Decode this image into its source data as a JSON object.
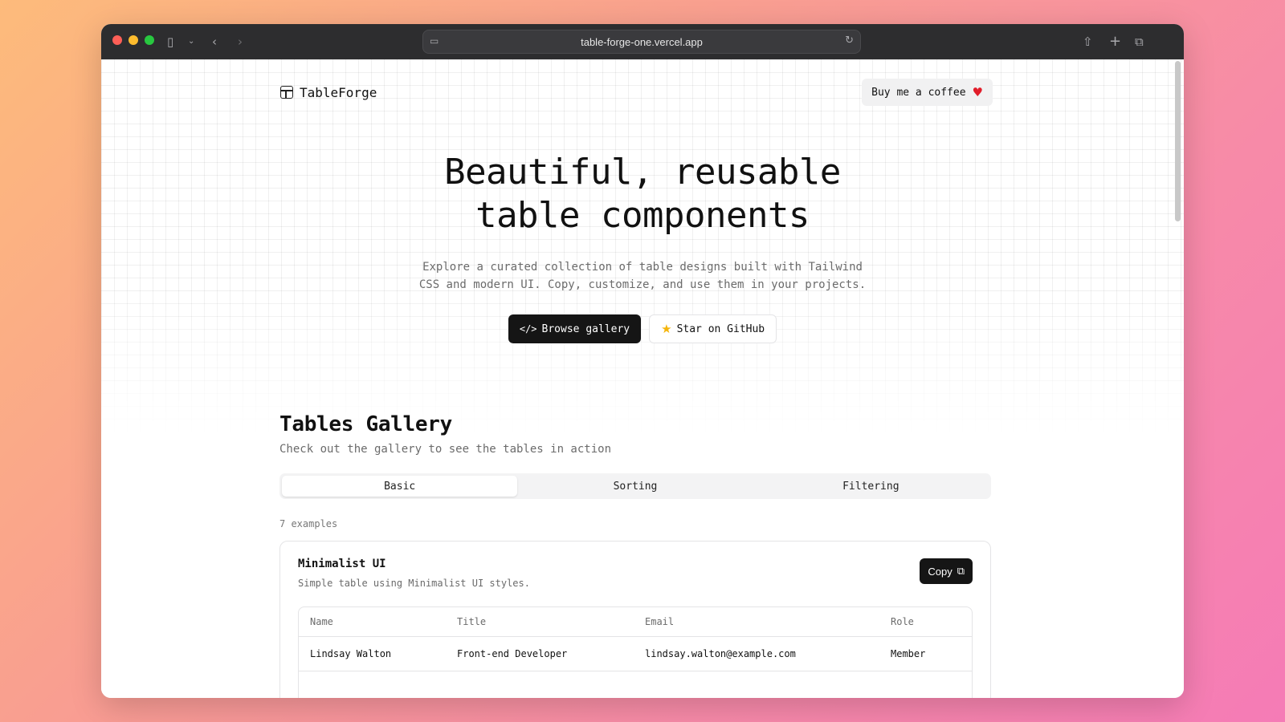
{
  "browser": {
    "url": "table-forge-one.vercel.app",
    "icons": [
      "sidebar-icon",
      "chevron-down-icon",
      "back-icon",
      "forward-icon",
      "site-settings-icon",
      "reload-icon",
      "share-icon",
      "new-tab-icon",
      "tabs-overview-icon"
    ]
  },
  "nav": {
    "brand": "TableForge",
    "coffee_label": "Buy me a coffee"
  },
  "hero": {
    "title_line1": "Beautiful, reusable",
    "title_line2": "table components",
    "description_line1": "Explore a curated collection of table designs built with Tailwind",
    "description_line2": "CSS and modern UI. Copy, customize, and use them in your projects.",
    "browse_label": "Browse gallery",
    "github_label": "Star on GitHub"
  },
  "gallery": {
    "title": "Tables Gallery",
    "subtitle": "Check out the gallery to see the tables in action",
    "tabs": [
      {
        "label": "Basic",
        "active": true
      },
      {
        "label": "Sorting",
        "active": false
      },
      {
        "label": "Filtering",
        "active": false
      }
    ],
    "count": "7 examples",
    "card": {
      "title": "Minimalist UI",
      "description": "Simple table using Minimalist UI styles.",
      "copy_label": "Copy",
      "columns": [
        "Name",
        "Title",
        "Email",
        "Role"
      ],
      "rows": [
        [
          "Lindsay Walton",
          "Front-end Developer",
          "lindsay.walton@example.com",
          "Member"
        ]
      ]
    }
  },
  "colors": {
    "accent_dark": "#151515",
    "heart": "#e11d2a",
    "star": "#f5b50b"
  }
}
